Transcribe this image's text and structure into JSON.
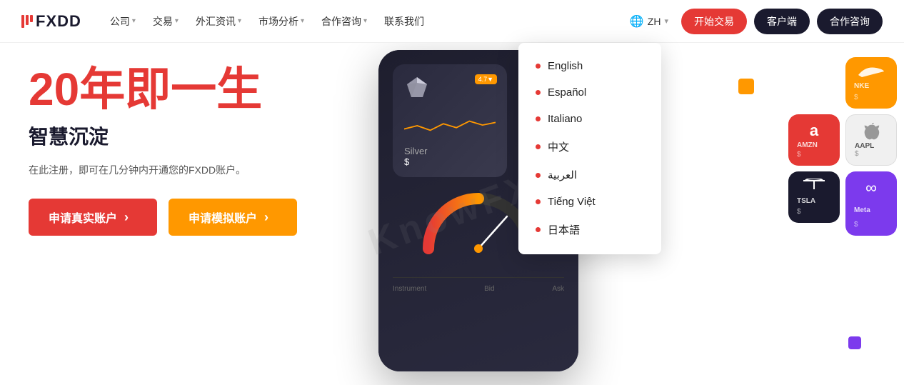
{
  "brand": {
    "name": "FXDD",
    "tagline": "//FXDD"
  },
  "navbar": {
    "logo_text": "FXDD",
    "nav_items": [
      {
        "label": "公司",
        "has_dropdown": true
      },
      {
        "label": "交易",
        "has_dropdown": true
      },
      {
        "label": "外汇资讯",
        "has_dropdown": true
      },
      {
        "label": "市场分析",
        "has_dropdown": true
      },
      {
        "label": "合作咨询",
        "has_dropdown": true
      },
      {
        "label": "联系我们",
        "has_dropdown": false
      }
    ],
    "lang_code": "ZH",
    "btn_start": "开始交易",
    "btn_client": "客户端",
    "btn_consult": "合作咨询"
  },
  "hero": {
    "title": "20年即一生",
    "subtitle": "智慧沉淀",
    "description": "在此注册，即可在几分钟内开通您的FXDD账户。",
    "cta_real": "申请真实账户",
    "cta_demo": "申请模拟账户",
    "arrow": "›"
  },
  "language_dropdown": {
    "options": [
      {
        "label": "English"
      },
      {
        "label": "Español"
      },
      {
        "label": "Italiano"
      },
      {
        "label": "中文"
      },
      {
        "label": "العربية"
      },
      {
        "label": "Tiếng Việt"
      },
      {
        "label": "日本語"
      }
    ]
  },
  "phone": {
    "silver_label": "Silver",
    "silver_price": "$",
    "silver_badge": "4.7▼",
    "instrument_label": "Instrument",
    "bid_label": "Bid",
    "ask_label": "Ask"
  },
  "stock_cards": [
    {
      "ticker": "NKE",
      "currency": "$",
      "color": "orange"
    },
    {
      "ticker": "AMZN",
      "currency": "$",
      "color": "red",
      "logo": "a"
    },
    {
      "ticker": "AAPL",
      "currency": "$",
      "color": "dark"
    },
    {
      "ticker": "TSLA",
      "currency": "$",
      "color": "dark2"
    },
    {
      "ticker": "Meta",
      "currency": "$",
      "color": "purple",
      "logo": "∞"
    }
  ],
  "watermark": "KnowFX"
}
